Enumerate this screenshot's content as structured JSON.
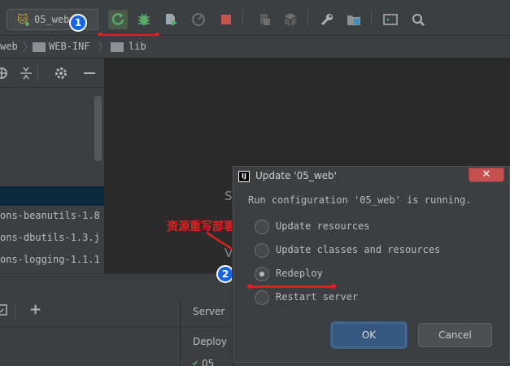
{
  "toolbar": {
    "run_config": "05_web",
    "icons": [
      "rerun-icon",
      "debug-icon",
      "coverage-icon",
      "profile-icon",
      "stop-icon",
      "build-icon",
      "build-artifacts-icon",
      "settings-wrench-icon",
      "project-structure-icon",
      "terminal-icon",
      "search-icon"
    ]
  },
  "breadcrumb": [
    "web",
    "WEB-INF",
    "lib"
  ],
  "project_tree": {
    "files": [
      "ons-beanutils-1.8",
      "ons-dbutils-1.3.j",
      "ons-logging-1.1.1"
    ]
  },
  "editor": {
    "ghost_top": "S",
    "ghost_bottom": "V"
  },
  "services": {
    "tab_server": "Server",
    "tab_deploy": "Deploy",
    "row_item": "05_"
  },
  "annotations": {
    "badge1": "1",
    "badge2": "2",
    "note": "资源重写部署"
  },
  "dialog": {
    "title": "Update '05_web'",
    "message": "Run configuration '05_web' is running.",
    "options": [
      {
        "label": "Update resources",
        "checked": false
      },
      {
        "label": "Update classes and resources",
        "checked": false
      },
      {
        "label": "Redeploy",
        "checked": true
      },
      {
        "label": "Restart server",
        "checked": false
      }
    ],
    "ok_label": "OK",
    "cancel_label": "Cancel",
    "close_symbol": "✕",
    "app_icon_text": "IJ"
  },
  "colors": {
    "accent_red": "#e02020",
    "badge_blue": "#1565e8",
    "rerun_green": "#59a869",
    "stop_red": "#c75450"
  }
}
